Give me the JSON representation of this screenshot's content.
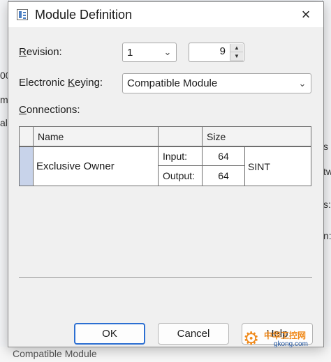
{
  "dialog": {
    "title": "Module Definition",
    "close_icon": "×"
  },
  "revision": {
    "label_accel": "R",
    "label_rest": "evision:",
    "major": "1",
    "minor": "9"
  },
  "keying": {
    "label_pre": "Electronic ",
    "label_accel": "K",
    "label_post": "eying:",
    "value": "Compatible Module"
  },
  "connections": {
    "label_accel": "C",
    "label_rest": "onnections:",
    "headers": {
      "name": "Name",
      "size": "Size"
    },
    "rows": [
      {
        "name": "Exclusive Owner",
        "input_label": "Input:",
        "input_size": "64",
        "output_label": "Output:",
        "output_size": "64",
        "type": "SINT"
      }
    ]
  },
  "buttons": {
    "ok": "OK",
    "cancel": "Cancel",
    "help": "Help"
  },
  "background": {
    "frag_1": "00",
    "frag_2": "m",
    "frag_3": "al",
    "frag_right_1": "s",
    "frag_right_2": "tw",
    "frag_right_3": "s:",
    "frag_right_4": "n:",
    "status_text": "Compatible Module"
  },
  "watermark": {
    "line1": "中华工控网",
    "line2": "gkong.com"
  },
  "colors": {
    "accent": "#2c6fd2",
    "row_selector": "#c8d3ea"
  }
}
